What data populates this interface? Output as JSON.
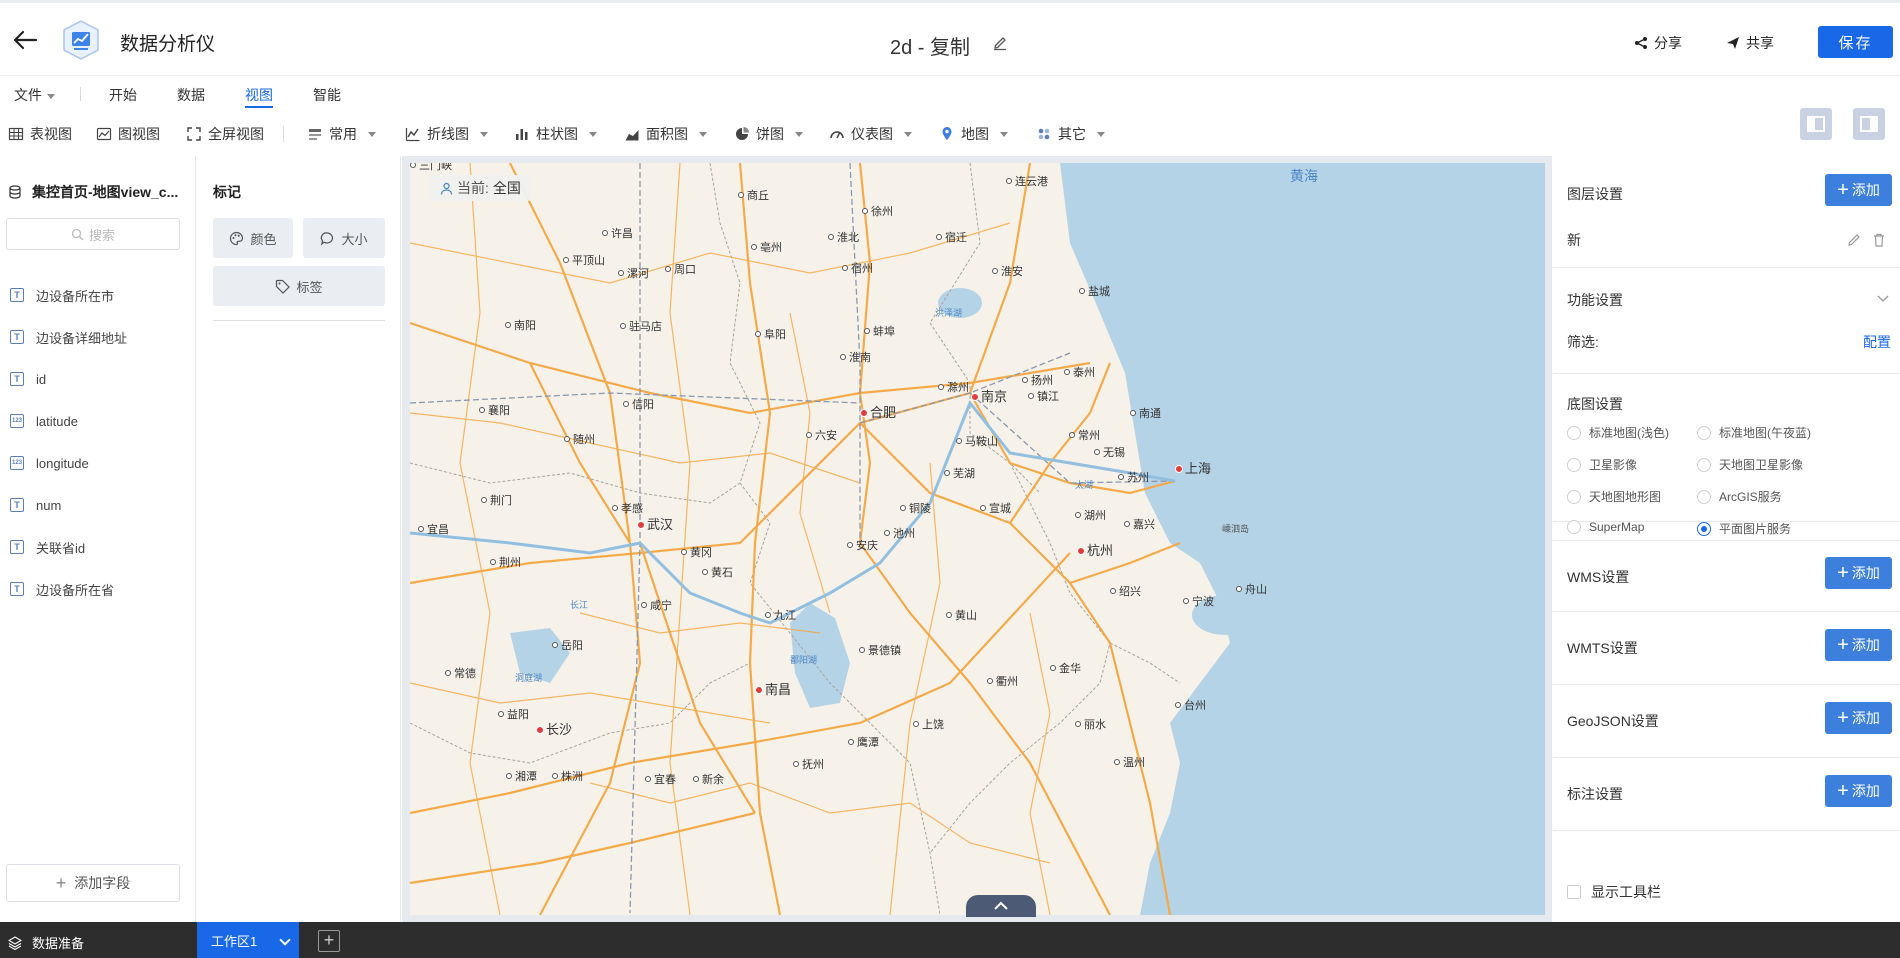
{
  "header": {
    "app_name": "数据分析仪",
    "doc_title": "2d - 复制",
    "share_label": "分享",
    "collab_label": "共享",
    "save_label": "保存"
  },
  "menu": {
    "file": "文件",
    "start": "开始",
    "data": "数据",
    "view": "视图",
    "smart": "智能",
    "active": "视图"
  },
  "toolbar": {
    "table_view": "表视图",
    "chart_view": "图视图",
    "fullscreen": "全屏视图",
    "common": "常用",
    "line": "折线图",
    "bar": "柱状图",
    "area": "面积图",
    "pie": "饼图",
    "gauge": "仪表图",
    "map": "地图",
    "other": "其它"
  },
  "left_panel": {
    "dataset": "集控首页-地图view_c...",
    "search_placeholder": "搜索",
    "fields": [
      {
        "name": "边设备所在市",
        "type": "T"
      },
      {
        "name": "边设备详细地址",
        "type": "T"
      },
      {
        "name": "id",
        "type": "T"
      },
      {
        "name": "latitude",
        "type": "123"
      },
      {
        "name": "longitude",
        "type": "123"
      },
      {
        "name": "num",
        "type": "T"
      },
      {
        "name": "关联省id",
        "type": "T"
      },
      {
        "name": "边设备所在省",
        "type": "T"
      }
    ],
    "add_field": "添加字段"
  },
  "marks": {
    "title": "标记",
    "color": "颜色",
    "size": "大小",
    "label": "标签"
  },
  "map": {
    "current_label": "当前:",
    "current_value": "全国",
    "sea_label": "黄海",
    "lake_labels": {
      "taihu": "太湖",
      "poyang": "鄱阳湖",
      "dongting": "洞庭湖",
      "hongze": "洪泽湖",
      "changjiang": "长江"
    },
    "island_label": "嵊泗岛",
    "cities": [
      {
        "name": "三门峡"
      },
      {
        "name": "连云港"
      },
      {
        "name": "商丘"
      },
      {
        "name": "徐州"
      },
      {
        "name": "许昌"
      },
      {
        "name": "亳州"
      },
      {
        "name": "淮北"
      },
      {
        "name": "宿迁"
      },
      {
        "name": "平顶山"
      },
      {
        "name": "漯河"
      },
      {
        "name": "周口"
      },
      {
        "name": "宿州"
      },
      {
        "name": "淮安"
      },
      {
        "name": "盐城"
      },
      {
        "name": "南阳"
      },
      {
        "name": "驻马店"
      },
      {
        "name": "阜阳"
      },
      {
        "name": "蚌埠"
      },
      {
        "name": "淮南"
      },
      {
        "name": "滁州"
      },
      {
        "name": "扬州"
      },
      {
        "name": "泰州"
      },
      {
        "name": "南京"
      },
      {
        "name": "镇江"
      },
      {
        "name": "南通"
      },
      {
        "name": "合肥"
      },
      {
        "name": "襄阳"
      },
      {
        "name": "信阳"
      },
      {
        "name": "六安"
      },
      {
        "name": "马鞍山"
      },
      {
        "name": "常州"
      },
      {
        "name": "随州"
      },
      {
        "name": "无锡"
      },
      {
        "name": "苏州"
      },
      {
        "name": "上海"
      },
      {
        "name": "芜湖"
      },
      {
        "name": "荆门"
      },
      {
        "name": "孝感"
      },
      {
        "name": "铜陵"
      },
      {
        "name": "宣城"
      },
      {
        "name": "湖州"
      },
      {
        "name": "嘉兴"
      },
      {
        "name": "宜昌"
      },
      {
        "name": "武汉"
      },
      {
        "name": "黄冈"
      },
      {
        "name": "安庆"
      },
      {
        "name": "池州"
      },
      {
        "name": "杭州"
      },
      {
        "name": "荆州"
      },
      {
        "name": "黄石"
      },
      {
        "name": "咸宁"
      },
      {
        "name": "绍兴"
      },
      {
        "name": "宁波"
      },
      {
        "name": "舟山"
      },
      {
        "name": "九江"
      },
      {
        "name": "黄山"
      },
      {
        "name": "岳阳"
      },
      {
        "name": "景德镇"
      },
      {
        "name": "常德"
      },
      {
        "name": "金华"
      },
      {
        "name": "衢州"
      },
      {
        "name": "南昌"
      },
      {
        "name": "益阳"
      },
      {
        "name": "台州"
      },
      {
        "name": "上饶"
      },
      {
        "name": "丽水"
      },
      {
        "name": "长沙"
      },
      {
        "name": "鹰潭"
      },
      {
        "name": "抚州"
      },
      {
        "name": "湘潭"
      },
      {
        "name": "株洲"
      },
      {
        "name": "宜春"
      },
      {
        "name": "新余"
      },
      {
        "name": "温州"
      }
    ]
  },
  "right_panel": {
    "layer_settings": "图层设置",
    "add": "添加",
    "layer_name": "新",
    "feature_settings": "功能设置",
    "filter": "筛选:",
    "config": "配置",
    "basemap_settings": "底图设置",
    "basemaps": [
      {
        "label": "标准地图(浅色)",
        "checked": false
      },
      {
        "label": "标准地图(午夜蓝)",
        "checked": false
      },
      {
        "label": "卫星影像",
        "checked": false
      },
      {
        "label": "天地图卫星影像",
        "checked": false
      },
      {
        "label": "天地图地形图",
        "checked": false
      },
      {
        "label": "ArcGIS服务",
        "checked": false
      },
      {
        "label": "SuperMap",
        "checked": false
      },
      {
        "label": "平面图片服务",
        "checked": true
      }
    ],
    "wms": "WMS设置",
    "wmts": "WMTS设置",
    "geojson": "GeoJSON设置",
    "annotation": "标注设置",
    "show_toolbar": "显示工具栏"
  },
  "bottom": {
    "data_prep": "数据准备",
    "workspace": "工作区1"
  },
  "colors": {
    "accent": "#1868e8",
    "add_button": "#3c7fdc",
    "road": "#f5a742",
    "water": "#b5d3e7",
    "land": "#f6f2ea"
  }
}
